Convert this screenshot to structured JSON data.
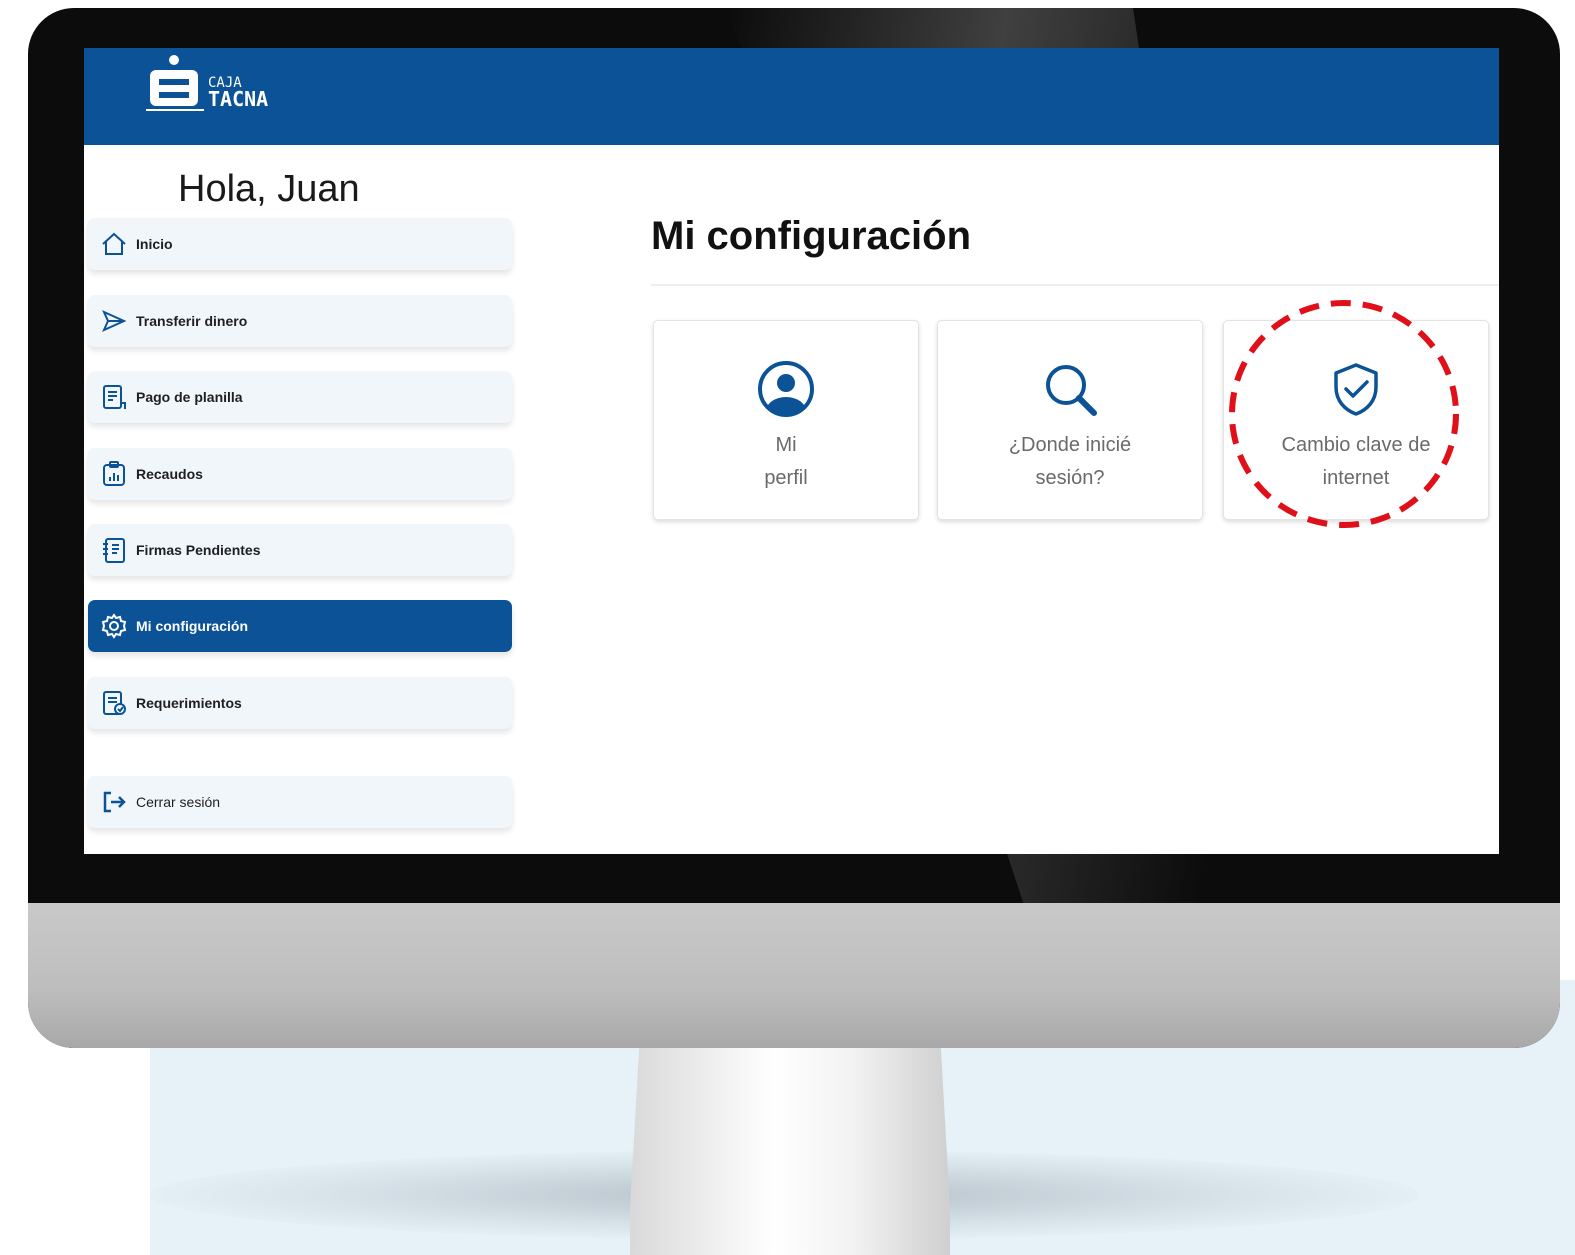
{
  "app": {
    "logo_icon": "caja-tacna-logo",
    "logo_text_top": "CAJA",
    "logo_text_bottom": "TACNA",
    "brand_color": "#0b5396"
  },
  "greeting": "Hola, Juan",
  "sidebar": {
    "items": [
      {
        "label": "Inicio",
        "icon": "home-icon",
        "active": false
      },
      {
        "label": "Transferir dinero",
        "icon": "send-icon",
        "active": false
      },
      {
        "label": "Pago de planilla",
        "icon": "document-icon",
        "active": false
      },
      {
        "label": "Recaudos",
        "icon": "clipboard-chart-icon",
        "active": false
      },
      {
        "label": "Firmas Pendientes",
        "icon": "notebook-icon",
        "active": false
      },
      {
        "label": "Mi configuración",
        "icon": "gear-icon",
        "active": true
      },
      {
        "label": "Requerimientos",
        "icon": "request-icon",
        "active": false
      }
    ],
    "logout": {
      "label": "Cerrar sesión",
      "icon": "logout-icon"
    }
  },
  "main": {
    "title": "Mi configuración",
    "cards": [
      {
        "label": "Mi\nperfil",
        "icon": "user-circle-icon"
      },
      {
        "label": "¿Donde inicié\nsesión?",
        "icon": "search-icon"
      },
      {
        "label": "Cambio clave de\ninternet",
        "icon": "shield-check-icon"
      }
    ]
  },
  "annotation": {
    "color": "#e0101a",
    "style": "dashed-circle"
  }
}
